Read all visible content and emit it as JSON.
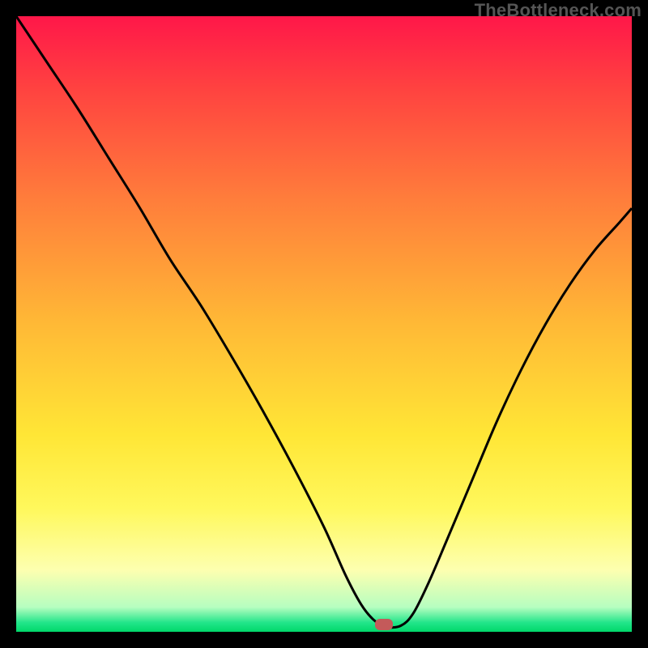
{
  "watermark": "TheBottleneck.com",
  "marker": {
    "x_frac": 0.597,
    "y_frac": 0.988
  },
  "chart_data": {
    "type": "line",
    "title": "",
    "xlabel": "",
    "ylabel": "",
    "x_range": [
      0,
      1
    ],
    "y_range": [
      0,
      1
    ],
    "grid": false,
    "legend": false,
    "series": [
      {
        "name": "bottleneck-curve",
        "color": "#000000",
        "x": [
          0.0,
          0.05,
          0.1,
          0.15,
          0.2,
          0.25,
          0.3,
          0.35,
          0.4,
          0.45,
          0.5,
          0.535,
          0.56,
          0.58,
          0.6,
          0.625,
          0.645,
          0.67,
          0.7,
          0.74,
          0.78,
          0.82,
          0.86,
          0.9,
          0.94,
          0.98,
          1.0
        ],
        "y": [
          1.0,
          0.925,
          0.85,
          0.77,
          0.69,
          0.605,
          0.53,
          0.447,
          0.36,
          0.268,
          0.17,
          0.092,
          0.045,
          0.02,
          0.008,
          0.01,
          0.03,
          0.08,
          0.15,
          0.245,
          0.34,
          0.425,
          0.5,
          0.565,
          0.62,
          0.665,
          0.688
        ]
      }
    ],
    "gradient_stops": [
      {
        "pos": 0.0,
        "color": "#ff1749"
      },
      {
        "pos": 0.12,
        "color": "#ff4340"
      },
      {
        "pos": 0.3,
        "color": "#ff7e3b"
      },
      {
        "pos": 0.5,
        "color": "#ffb936"
      },
      {
        "pos": 0.68,
        "color": "#ffe636"
      },
      {
        "pos": 0.8,
        "color": "#fff85c"
      },
      {
        "pos": 0.9,
        "color": "#fdffb0"
      },
      {
        "pos": 0.96,
        "color": "#b6fec0"
      },
      {
        "pos": 0.985,
        "color": "#22e58a"
      },
      {
        "pos": 1.0,
        "color": "#00d86a"
      }
    ]
  }
}
